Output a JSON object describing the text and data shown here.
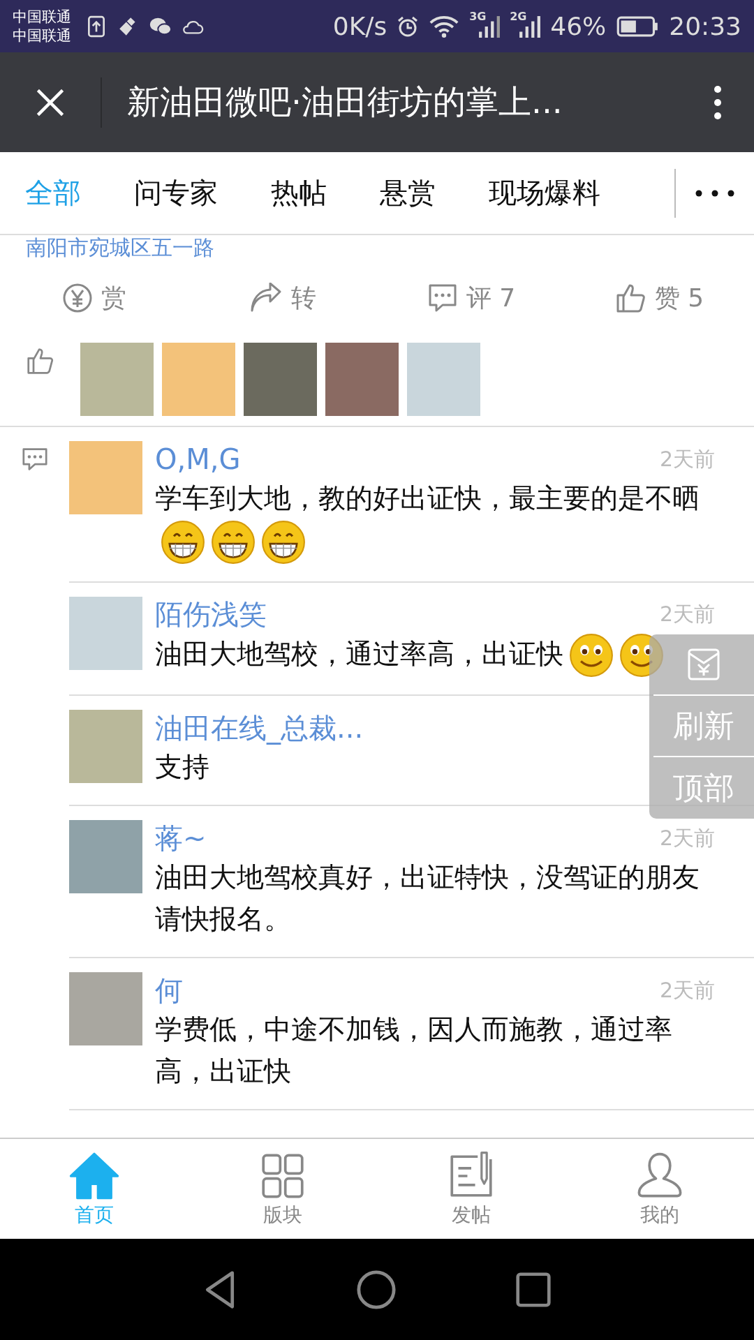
{
  "status_bar": {
    "carriers": [
      "中国联通",
      "中国联通"
    ],
    "speed": "0K/s",
    "network_1": "3G",
    "network_2": "2G",
    "battery": "46%",
    "time": "20:33"
  },
  "title_bar": {
    "title": "新油田微吧·油田街坊的掌上..."
  },
  "tabs": [
    {
      "label": "全部",
      "selected": true
    },
    {
      "label": "问专家",
      "selected": false
    },
    {
      "label": "热帖",
      "selected": false
    },
    {
      "label": "悬赏",
      "selected": false
    },
    {
      "label": "现场爆料",
      "selected": false
    }
  ],
  "post": {
    "address": "南阳市宛城区五一路",
    "actions": [
      {
        "kind": "reward",
        "label": "赏"
      },
      {
        "kind": "share",
        "label": "转"
      },
      {
        "kind": "comment",
        "label": "评 7"
      },
      {
        "kind": "like",
        "label": "赞 5"
      }
    ]
  },
  "comments": [
    {
      "name": "O,M,G",
      "time": "2天前",
      "text": "学车到大地，教的好出证快，最主要的是不晒",
      "emoji": [
        {
          "kind": "grin"
        },
        {
          "kind": "grin"
        },
        {
          "kind": "grin"
        }
      ]
    },
    {
      "name": "陌伤浅笑",
      "time": "2天前",
      "text": "油田大地驾校，通过率高，出证快",
      "emoji": [
        {
          "kind": "smile"
        },
        {
          "kind": "smile"
        }
      ]
    },
    {
      "name": "油田在线_总裁...",
      "text": "支持"
    },
    {
      "name": "蒋~",
      "time": "2天前",
      "text": "油田大地驾校真好，出证特快，没驾证的朋友请快报名。"
    },
    {
      "name": "何",
      "time": "2天前",
      "text": "学费低，中途不加钱，因人而施教，通过率高，出证快"
    }
  ],
  "float_menu": {
    "refresh": "刷新",
    "top": "顶部"
  },
  "bottom_nav": [
    {
      "kind": "home",
      "label": "首页",
      "selected": true
    },
    {
      "kind": "grid",
      "label": "版块",
      "selected": false
    },
    {
      "kind": "post",
      "label": "发帖",
      "selected": false
    },
    {
      "kind": "user",
      "label": "我的",
      "selected": false
    }
  ]
}
